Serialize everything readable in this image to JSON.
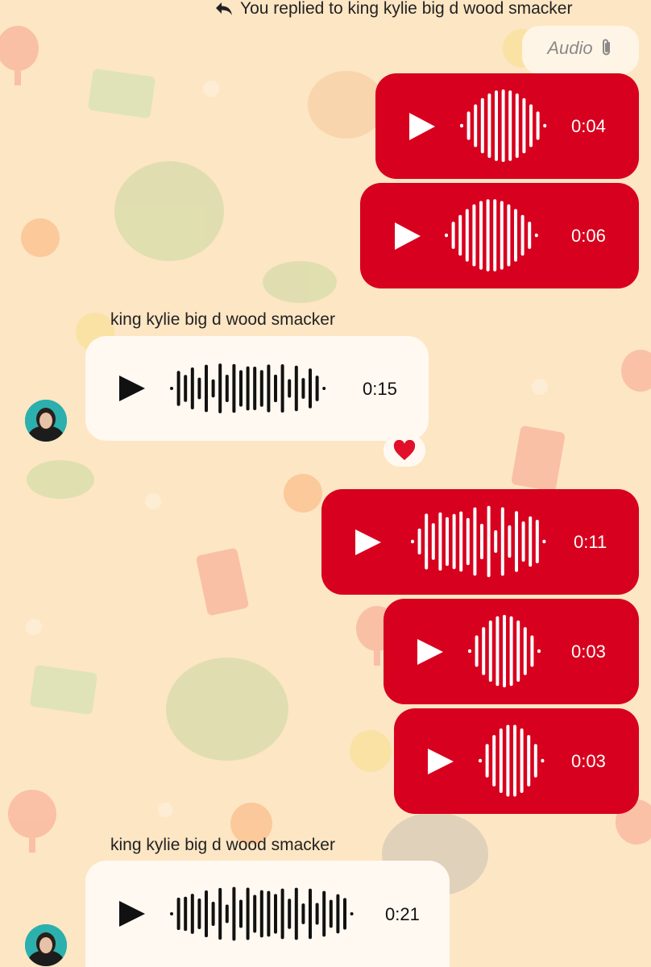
{
  "reply_header": {
    "icon": "reply-arrow-icon",
    "text": "You replied to king kylie big d wood smacker"
  },
  "audio_tag": {
    "label": "Audio",
    "icon": "paperclip-icon"
  },
  "colors": {
    "background": "#fde6c4",
    "outgoing_bubble": "#d7001e",
    "incoming_bubble": "#fff9f1",
    "reaction_heart": "#e0102a"
  },
  "messages": [
    {
      "direction": "outgoing",
      "type": "voice",
      "duration": "0:04"
    },
    {
      "direction": "outgoing",
      "type": "voice",
      "duration": "0:06"
    },
    {
      "direction": "incoming",
      "type": "voice",
      "sender": "king kylie big d wood smacker",
      "duration": "0:15",
      "reaction": "heart"
    },
    {
      "direction": "outgoing",
      "type": "voice",
      "duration": "0:11"
    },
    {
      "direction": "outgoing",
      "type": "voice",
      "duration": "0:03"
    },
    {
      "direction": "outgoing",
      "type": "voice",
      "duration": "0:03"
    },
    {
      "direction": "incoming",
      "type": "voice",
      "sender": "king kylie big d wood smacker",
      "duration": "0:21"
    }
  ]
}
